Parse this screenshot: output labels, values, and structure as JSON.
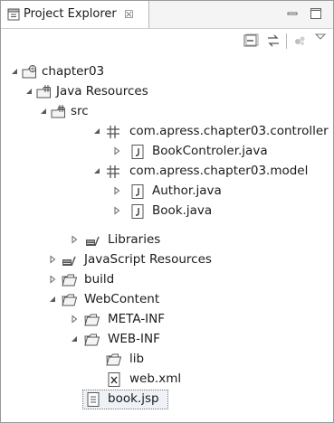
{
  "view": {
    "title": "Project Explorer",
    "close_glyph": "☒",
    "icons": {
      "tab": "project-explorer-icon",
      "minimize": "minimize-icon",
      "maximize": "maximize-icon"
    }
  },
  "toolbar": {
    "icons": [
      "collapse-all-icon",
      "link-with-editor-icon",
      "focus-icon",
      "view-menu-icon"
    ]
  },
  "tree": {
    "chapter03": "chapter03",
    "java_resources": "Java Resources",
    "src": "src",
    "pkg_controller": "com.apress.chapter03.controller",
    "bookcontroler": "BookControler.java",
    "pkg_model": "com.apress.chapter03.model",
    "author": "Author.java",
    "book": "Book.java",
    "libraries": "Libraries",
    "javascript_resources": "JavaScript Resources",
    "build": "build",
    "webcontent": "WebContent",
    "meta_inf": "META-INF",
    "web_inf": "WEB-INF",
    "lib": "lib",
    "web_xml": "web.xml",
    "book_jsp": "book.jsp",
    "selected": "book.jsp"
  }
}
